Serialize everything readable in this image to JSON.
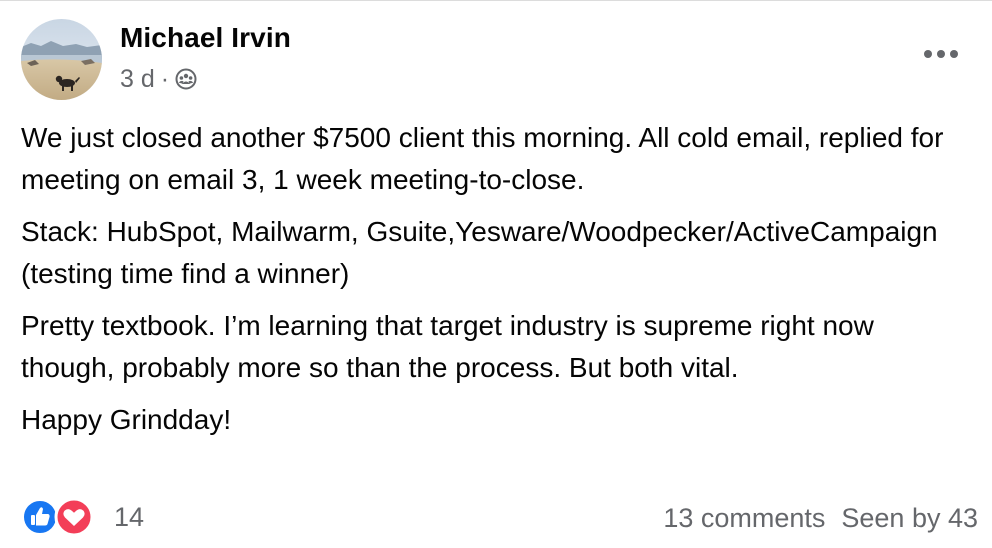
{
  "post": {
    "author": "Michael Irvin",
    "time": "3 d",
    "separator": "·",
    "audience_icon": "group-icon",
    "paragraphs": [
      "We just closed another $7500 client this morning. All cold email, replied for meeting on email 3, 1 week meeting-to-close.",
      "Stack: HubSpot, Mailwarm, Gsuite,Yesware/Woodpecker/ActiveCampaign (testing time find a winner)",
      "Pretty textbook. I’m learning that target industry is supreme right now though, probably more so than the process. But both vital.",
      "Happy Grindday!"
    ]
  },
  "footer": {
    "reaction_count": "14",
    "comments": "13 comments",
    "seen_by": "Seen by 43"
  },
  "colors": {
    "like_blue": "#1877f2",
    "love_red": "#f33e58",
    "meta_gray": "#65676b"
  }
}
